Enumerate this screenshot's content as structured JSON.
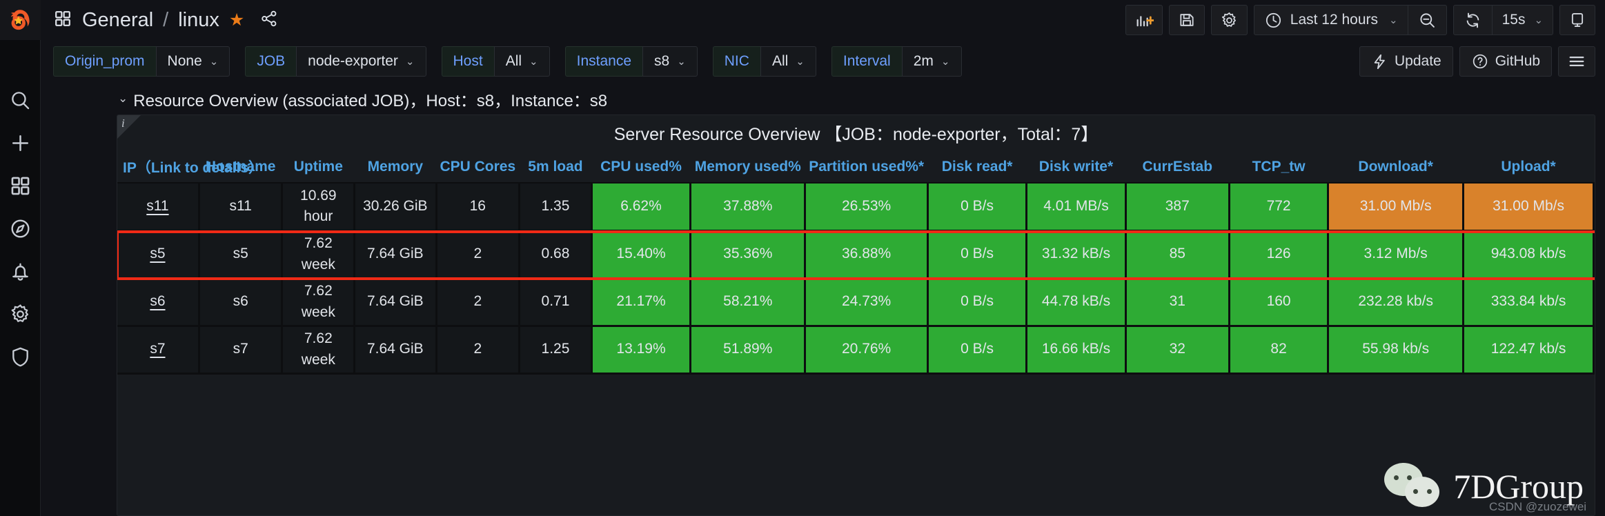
{
  "sidebar": {
    "logo_icon": "grafana-logo-icon",
    "items": [
      {
        "icon": "search-icon",
        "name": "search"
      },
      {
        "icon": "plus-icon",
        "name": "create"
      },
      {
        "icon": "dashboards-icon",
        "name": "dashboards"
      },
      {
        "icon": "compass-icon",
        "name": "explore"
      },
      {
        "icon": "bell-icon",
        "name": "alerting"
      },
      {
        "icon": "gear-icon",
        "name": "configuration"
      },
      {
        "icon": "shield-icon",
        "name": "server-admin"
      }
    ]
  },
  "topbar": {
    "dashboards_icon": "dashboards-grid-icon",
    "folder": "General",
    "separator": "/",
    "dashboard": "linux",
    "star_icon": "star-icon",
    "share_icon": "share-icon",
    "add_panel_icon": "add-panel-icon",
    "save_icon": "save-icon",
    "settings_icon": "gear-icon",
    "time_icon": "clock-icon",
    "time_range": "Last 12 hours",
    "time_caret": "⌄",
    "zoom_out_icon": "zoom-out-icon",
    "refresh_icon": "refresh-icon",
    "refresh_interval": "15s",
    "refresh_caret": "⌄",
    "tv_icon": "tv-mode-icon"
  },
  "variables": [
    {
      "label": "Origin_prom",
      "value": "None",
      "caret": "⌄",
      "has_caret": true
    },
    {
      "label": "JOB",
      "value": "node-exporter",
      "caret": "⌄",
      "has_caret": true
    },
    {
      "label": "Host",
      "value": "All",
      "caret": "⌄",
      "has_caret": true
    },
    {
      "label": "Instance",
      "value": "s8",
      "caret": "⌄",
      "has_caret": true
    },
    {
      "label": "NIC",
      "value": "All",
      "caret": "⌄",
      "has_caret": true
    },
    {
      "label": "Interval",
      "value": "2m",
      "caret": "⌄",
      "has_caret": true
    }
  ],
  "actions": {
    "update_icon": "lightning-bolt-icon",
    "update_label": "Update",
    "github_icon": "question-circle-icon",
    "github_label": "GitHub",
    "menu_icon": "hamburger-menu-icon"
  },
  "row": {
    "chevron": "⌄",
    "title": "Resource Overview (associated JOB)，Host：s8，Instance：s8"
  },
  "panel": {
    "info_icon": "info-icon",
    "title": "Server Resource Overview 【JOB：node-exporter，Total：7】"
  },
  "table": {
    "headers": [
      "IP（Link to details）",
      "Hostname",
      "Uptime",
      "Memory",
      "CPU Cores",
      "5m load",
      "CPU used%",
      "Memory used%",
      "Partition used%*",
      "Disk read*",
      "Disk write*",
      "CurrEstab",
      "TCP_tw",
      "Download*",
      "Upload*"
    ],
    "rows": [
      {
        "highlighted": false,
        "cells": [
          {
            "text": "s11",
            "style": "link"
          },
          {
            "text": "s11",
            "style": "plain"
          },
          {
            "text": "10.69 hour",
            "style": "plain"
          },
          {
            "text": "30.26 GiB",
            "style": "plain"
          },
          {
            "text": "16",
            "style": "plain"
          },
          {
            "text": "1.35",
            "style": "plain"
          },
          {
            "text": "6.62%",
            "style": "green"
          },
          {
            "text": "37.88%",
            "style": "green"
          },
          {
            "text": "26.53%",
            "style": "green"
          },
          {
            "text": "0 B/s",
            "style": "green"
          },
          {
            "text": "4.01 MB/s",
            "style": "green"
          },
          {
            "text": "387",
            "style": "green"
          },
          {
            "text": "772",
            "style": "green"
          },
          {
            "text": "31.00 Mb/s",
            "style": "orange"
          },
          {
            "text": "31.00 Mb/s",
            "style": "orange"
          }
        ]
      },
      {
        "highlighted": true,
        "cells": [
          {
            "text": "s5",
            "style": "link"
          },
          {
            "text": "s5",
            "style": "plain"
          },
          {
            "text": "7.62 week",
            "style": "plain"
          },
          {
            "text": "7.64 GiB",
            "style": "plain"
          },
          {
            "text": "2",
            "style": "plain"
          },
          {
            "text": "0.68",
            "style": "plain"
          },
          {
            "text": "15.40%",
            "style": "green"
          },
          {
            "text": "35.36%",
            "style": "green"
          },
          {
            "text": "36.88%",
            "style": "green"
          },
          {
            "text": "0 B/s",
            "style": "green"
          },
          {
            "text": "31.32 kB/s",
            "style": "green"
          },
          {
            "text": "85",
            "style": "green"
          },
          {
            "text": "126",
            "style": "green"
          },
          {
            "text": "3.12 Mb/s",
            "style": "green"
          },
          {
            "text": "943.08 kb/s",
            "style": "green"
          }
        ]
      },
      {
        "highlighted": false,
        "cells": [
          {
            "text": "s6",
            "style": "link"
          },
          {
            "text": "s6",
            "style": "plain"
          },
          {
            "text": "7.62 week",
            "style": "plain"
          },
          {
            "text": "7.64 GiB",
            "style": "plain"
          },
          {
            "text": "2",
            "style": "plain"
          },
          {
            "text": "0.71",
            "style": "plain"
          },
          {
            "text": "21.17%",
            "style": "green"
          },
          {
            "text": "58.21%",
            "style": "green"
          },
          {
            "text": "24.73%",
            "style": "green"
          },
          {
            "text": "0 B/s",
            "style": "green"
          },
          {
            "text": "44.78 kB/s",
            "style": "green"
          },
          {
            "text": "31",
            "style": "green"
          },
          {
            "text": "160",
            "style": "green"
          },
          {
            "text": "232.28 kb/s",
            "style": "green"
          },
          {
            "text": "333.84 kb/s",
            "style": "green"
          }
        ]
      },
      {
        "highlighted": false,
        "cells": [
          {
            "text": "s7",
            "style": "link"
          },
          {
            "text": "s7",
            "style": "plain"
          },
          {
            "text": "7.62 week",
            "style": "plain"
          },
          {
            "text": "7.64 GiB",
            "style": "plain"
          },
          {
            "text": "2",
            "style": "plain"
          },
          {
            "text": "1.25",
            "style": "plain"
          },
          {
            "text": "13.19%",
            "style": "green"
          },
          {
            "text": "51.89%",
            "style": "green"
          },
          {
            "text": "20.76%",
            "style": "green"
          },
          {
            "text": "0 B/s",
            "style": "green"
          },
          {
            "text": "16.66 kB/s",
            "style": "green"
          },
          {
            "text": "32",
            "style": "green"
          },
          {
            "text": "82",
            "style": "green"
          },
          {
            "text": "55.98 kb/s",
            "style": "green"
          },
          {
            "text": "122.47 kb/s",
            "style": "green"
          }
        ]
      }
    ]
  },
  "watermark": {
    "text": "7DGroup",
    "logo_icon": "wechat-icon"
  },
  "credit": "CSDN @zuozewei",
  "colors": {
    "green": "#2eab34",
    "orange": "#d9822b",
    "highlight": "#f02a16",
    "link_blue": "#6e9fff",
    "header_blue": "#4fa3e3",
    "brand_orange": "#eb7b18"
  }
}
